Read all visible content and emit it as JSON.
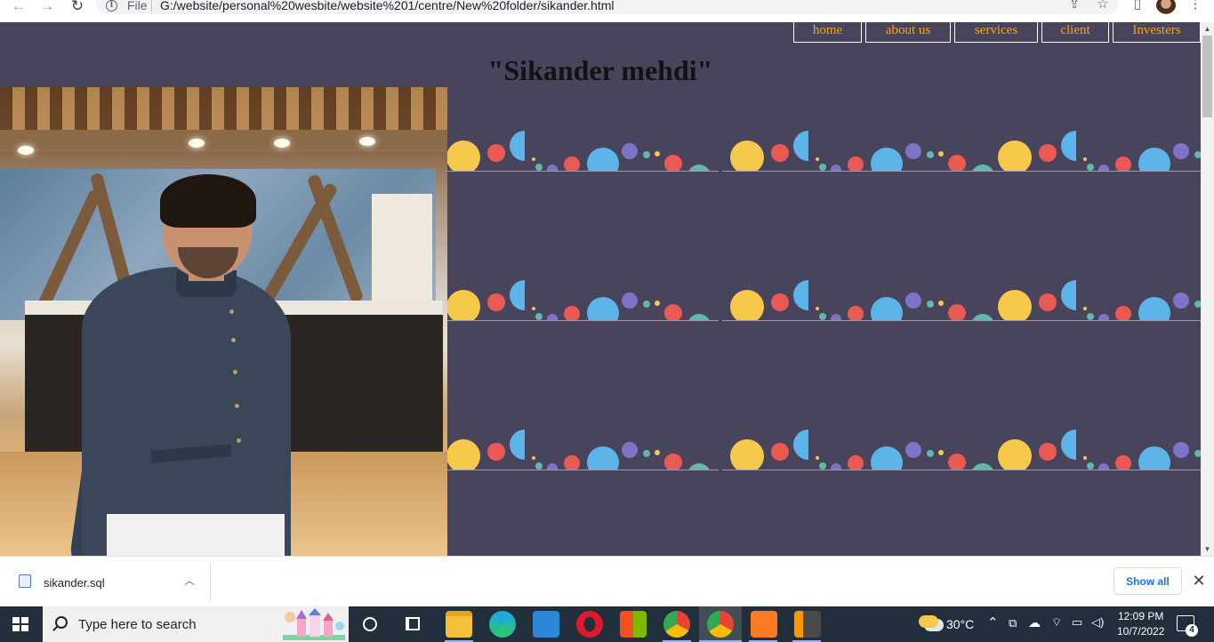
{
  "browser": {
    "file_label": "File",
    "url": "G:/website/personal%20wesbite/website%201/centre/New%20folder/sikander.html",
    "icons": [
      "back-arrow-icon",
      "forward-arrow-icon",
      "reload-icon",
      "info-icon",
      "share-icon",
      "star-icon",
      "side-panel-icon",
      "profile-avatar",
      "menu-kebab-icon"
    ]
  },
  "site": {
    "nav": [
      {
        "label": "home"
      },
      {
        "label": "about us"
      },
      {
        "label": "services"
      },
      {
        "label": "client"
      },
      {
        "label": "Investers"
      }
    ],
    "title": "\"Sikander mehdi\"",
    "colors": {
      "background": "#47445c",
      "nav_text": "#ffa500",
      "title": "#121212"
    }
  },
  "downloads": {
    "file_name": "sikander.sql",
    "show_all": "Show all"
  },
  "taskbar": {
    "search_placeholder": "Type here to search",
    "weather": "30°C",
    "time": "12:09 PM",
    "date": "10/7/2022",
    "notification_count": "4",
    "apps": [
      "task-view",
      "file-explorer",
      "edge",
      "mail",
      "opera",
      "microsoft-store",
      "chrome-profile",
      "chrome-active",
      "xampp",
      "sublime-text"
    ]
  }
}
